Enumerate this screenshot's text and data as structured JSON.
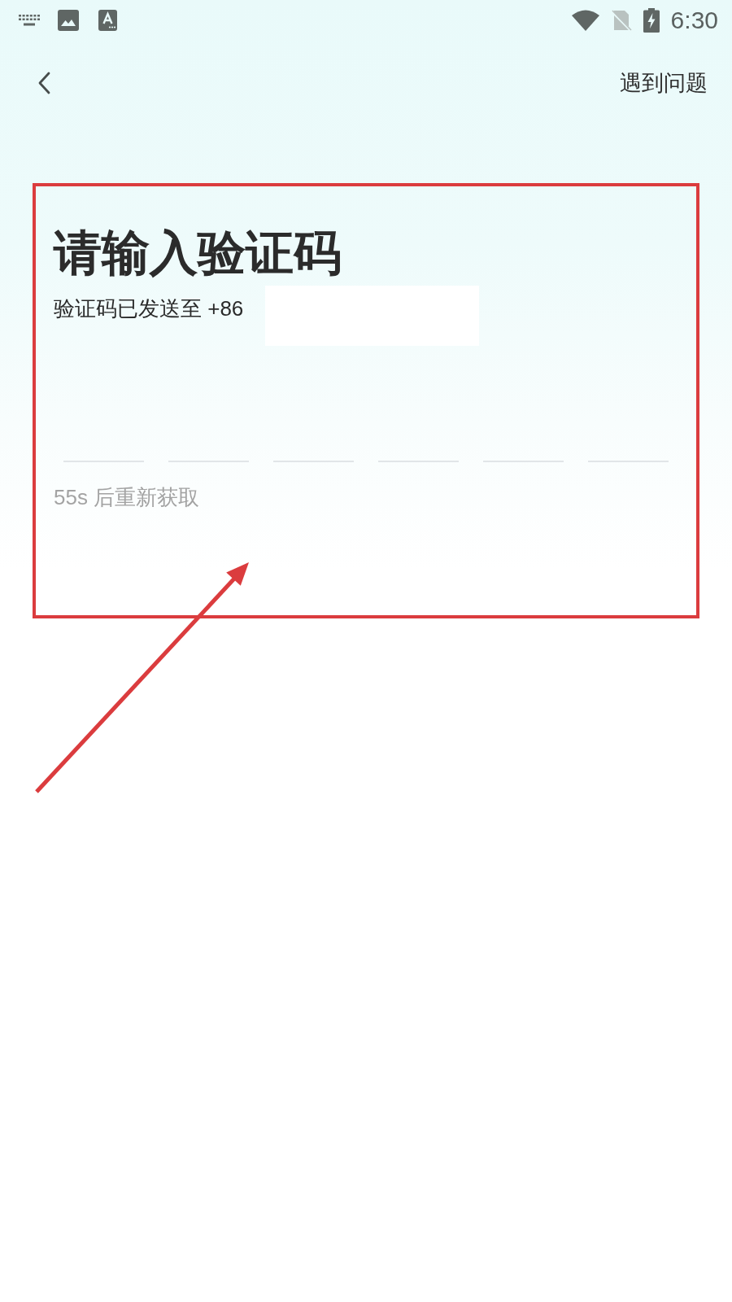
{
  "status_bar": {
    "time": "6:30"
  },
  "header": {
    "help_link": "遇到问题"
  },
  "title": "请输入验证码",
  "subtitle": "验证码已发送至 +86",
  "code_inputs": [
    {
      "kind": "underline"
    },
    {
      "kind": "underline"
    },
    {
      "kind": "underline"
    },
    {
      "kind": "underline"
    },
    {
      "kind": "underline"
    },
    {
      "kind": "underline"
    }
  ],
  "resend": "55s 后重新获取"
}
